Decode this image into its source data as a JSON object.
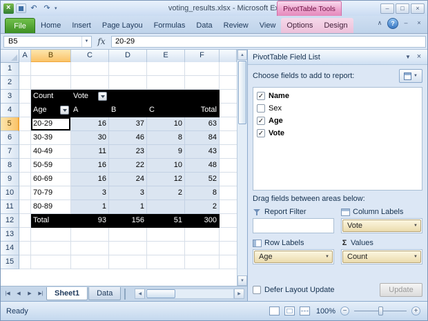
{
  "titlebar": {
    "title": "voting_results.xlsx  -  Microsoft Excel",
    "contextual_group": "PivotTable Tools"
  },
  "ribbon": {
    "file_tab": "File",
    "tabs": [
      "Home",
      "Insert",
      "Page Layou",
      "Formulas",
      "Data",
      "Review",
      "View"
    ],
    "contextual_tabs": [
      "Options",
      "Design"
    ]
  },
  "formula_bar": {
    "name_box": "B5",
    "fx_label": "fx",
    "value": "20-29"
  },
  "grid": {
    "columns": [
      "A",
      "B",
      "C",
      "D",
      "E",
      "F"
    ],
    "rows": [
      "1",
      "2",
      "3",
      "4",
      "5",
      "6",
      "7",
      "8",
      "9",
      "10",
      "11",
      "12",
      "13",
      "14",
      "15"
    ],
    "selected_cell": "B5",
    "selected_col": "B",
    "selected_row": "5"
  },
  "pivot": {
    "count_label": "Count",
    "column_field": "Vote",
    "row_field": "Age",
    "value_headers": [
      "A",
      "B",
      "C",
      "Total"
    ],
    "data_rows": [
      [
        "20-29",
        "16",
        "37",
        "10",
        "63"
      ],
      [
        "30-39",
        "30",
        "46",
        "8",
        "84"
      ],
      [
        "40-49",
        "11",
        "23",
        "9",
        "43"
      ],
      [
        "50-59",
        "16",
        "22",
        "10",
        "48"
      ],
      [
        "60-69",
        "16",
        "24",
        "12",
        "52"
      ],
      [
        "70-79",
        "3",
        "3",
        "2",
        "8"
      ],
      [
        "80-89",
        "1",
        "1",
        "",
        "2"
      ]
    ],
    "total_row": [
      "Total",
      "93",
      "156",
      "51",
      "300"
    ]
  },
  "sheet_tabs": {
    "tabs": [
      "Sheet1",
      "Data"
    ],
    "active": "Sheet1"
  },
  "field_list": {
    "title": "PivotTable Field List",
    "choose_label": "Choose fields to add to report:",
    "fields": [
      {
        "name": "Name",
        "checked": true
      },
      {
        "name": "Sex",
        "checked": false
      },
      {
        "name": "Age",
        "checked": true
      },
      {
        "name": "Vote",
        "checked": true
      }
    ],
    "drag_label": "Drag fields between areas below:",
    "areas": [
      {
        "label": "Report Filter",
        "icon": "filter-icon",
        "value": null
      },
      {
        "label": "Column Labels",
        "icon": "column-labels-icon",
        "value": "Vote"
      },
      {
        "label": "Row Labels",
        "icon": "row-labels-icon",
        "value": "Age"
      },
      {
        "label": "Values",
        "icon": "sigma-icon",
        "value": "Count"
      }
    ],
    "defer_label": "Defer Layout Update",
    "update_button": "Update"
  },
  "status_bar": {
    "ready": "Ready",
    "zoom": "100%"
  }
}
